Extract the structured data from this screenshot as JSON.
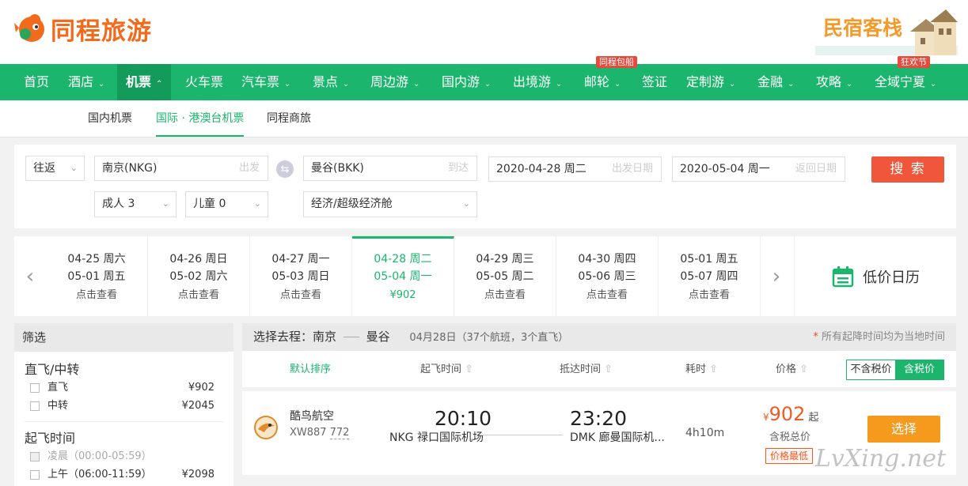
{
  "brand": {
    "name": "同程旅游"
  },
  "minsu": {
    "label": "民宿客栈"
  },
  "nav": {
    "items": [
      {
        "label": "首页"
      },
      {
        "label": "酒店"
      },
      {
        "label": "机票"
      },
      {
        "label": "火车票"
      },
      {
        "label": "汽车票"
      },
      {
        "label": "景点"
      },
      {
        "label": "周边游"
      },
      {
        "label": "国内游"
      },
      {
        "label": "出境游"
      },
      {
        "label": "邮轮"
      },
      {
        "label": "签证"
      },
      {
        "label": "定制游"
      },
      {
        "label": "金融"
      },
      {
        "label": "攻略"
      },
      {
        "label": "全域宁夏"
      }
    ],
    "badges": {
      "cruise": "同程包船",
      "ningxia": "狂欢节"
    },
    "chevron": "chevron-down-icon"
  },
  "subnav": {
    "items": [
      {
        "label": "国内机票"
      },
      {
        "label": "国际 · 港澳台机票"
      },
      {
        "label": "同程商旅"
      }
    ]
  },
  "search": {
    "trip_type": "往返",
    "from": "南京(NKG)",
    "from_hint": "出发",
    "to": "曼谷(BKK)",
    "to_hint": "到达",
    "depart_date": "2020-04-28 周二",
    "depart_hint": "出发日期",
    "return_date": "2020-05-04 周一",
    "return_hint": "返回日期",
    "adults": "成人 3",
    "children": "儿童 0",
    "cabin": "经济/超级经济舱",
    "button": "搜 索"
  },
  "date_strip": {
    "cells": [
      {
        "dep": "04-25 周六",
        "ret": "05-01 周五",
        "info": "点击查看"
      },
      {
        "dep": "04-26 周日",
        "ret": "05-02 周六",
        "info": "点击查看"
      },
      {
        "dep": "04-27 周一",
        "ret": "05-03 周日",
        "info": "点击查看"
      },
      {
        "dep": "04-28 周二",
        "ret": "05-04 周一",
        "info": "¥902"
      },
      {
        "dep": "04-29 周三",
        "ret": "05-05 周二",
        "info": "点击查看"
      },
      {
        "dep": "04-30 周四",
        "ret": "05-06 周三",
        "info": "点击查看"
      },
      {
        "dep": "05-01 周五",
        "ret": "05-07 周四",
        "info": "点击查看"
      }
    ],
    "low_price_calendar": "低价日历"
  },
  "filter": {
    "title": "筛选",
    "groups": [
      {
        "title": "直飞/中转",
        "options": [
          {
            "label": "直飞",
            "price": "¥902"
          },
          {
            "label": "中转",
            "price": "¥2045"
          }
        ]
      },
      {
        "title": "起飞时间",
        "options": [
          {
            "label": "凌晨（00:00-05:59）",
            "price": ""
          },
          {
            "label": "上午（06:00-11:59）",
            "price": "¥2098"
          }
        ]
      }
    ]
  },
  "results": {
    "heading_prefix": "选择去程：",
    "from_city": "南京",
    "to_city": "曼谷",
    "date_info": "04月28日（37个航班，3个直飞）",
    "note_star": "*",
    "note": " 所有起降时间均为当地时间",
    "sort": {
      "default": "默认排序",
      "dep_time": "起飞时间",
      "arr_time": "抵达时间",
      "duration": "耗时",
      "price": "价格"
    },
    "tax": {
      "exclude": "不含税价",
      "include": "含税价"
    },
    "flights": [
      {
        "airline": "酷鸟航空",
        "flight_no": "XW887",
        "aircraft": "772",
        "dep_time": "20:10",
        "dep_airport": "NKG 禄口国际机场",
        "arr_time": "23:20",
        "arr_airport": "DMK 廊曼国际机...",
        "duration": "4h10m",
        "currency": "¥",
        "price": "902",
        "price_suffix": "起",
        "price_note": "含税总价",
        "tag": "价格最低",
        "button": "选择"
      }
    ]
  },
  "watermark": "LvXing.net"
}
